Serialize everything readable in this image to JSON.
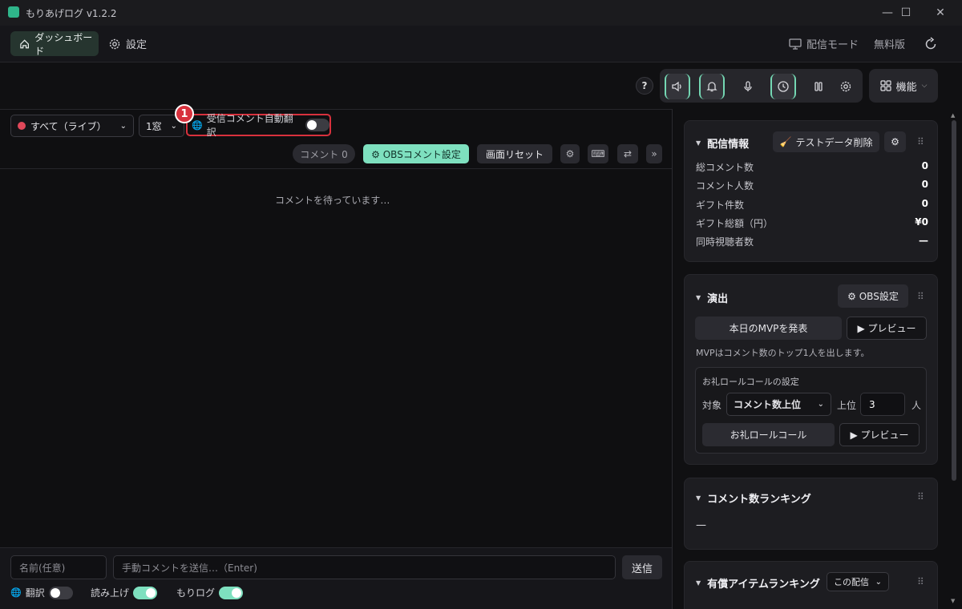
{
  "window": {
    "title": "もりあげログ  v1.2.2",
    "minimize": "—",
    "maximize": "☐",
    "close": "✕"
  },
  "nav": {
    "dashboard": "ダッシュボード",
    "settings": "設定",
    "stream_mode": "配信モード",
    "free_version": "無料版"
  },
  "toolbar": {
    "help": "?",
    "features": "機能"
  },
  "comments": {
    "source_select": "すべて（ライブ）",
    "window_select": "1窓",
    "auto_translate_label": "受信コメント自動翻訳",
    "auto_translate_on": false,
    "annotation_number": "1",
    "comment_count_label": "コメント 0",
    "obs_comment_settings": "⚙ OBSコメント設定",
    "reset_screen": "画面リセット",
    "waiting_text": "コメントを待っています…",
    "icon_gear": "⚙",
    "icon_keyboard": "⌨",
    "icon_swap": "⇄",
    "icon_more": "»"
  },
  "composer": {
    "name_placeholder": "名前(任意)",
    "comment_placeholder": "手動コメントを送信…（Enter)",
    "send": "送信",
    "translate_label": "翻訳",
    "read_aloud_label": "読み上げ",
    "moriloq_label": "もりログ",
    "translate_on": false,
    "read_aloud_on": true,
    "moriloq_on": true
  },
  "stream_info": {
    "title": "配信情報",
    "delete_test_data": "テストデータ削除",
    "rows": [
      {
        "label": "総コメント数",
        "value": "0"
      },
      {
        "label": "コメント人数",
        "value": "0"
      },
      {
        "label": "ギフト件数",
        "value": "0"
      },
      {
        "label": "ギフト総額（円）",
        "value": "¥0"
      },
      {
        "label": "同時視聴者数",
        "value": "—"
      }
    ]
  },
  "effects": {
    "title": "演出",
    "obs_settings": "⚙ OBS設定",
    "announce_mvp": "本日のMVPを発表",
    "preview": "▶ プレビュー",
    "mvp_note": "MVPはコメント数のトップ1人を出します。",
    "rollcall_title": "お礼ロールコールの設定",
    "target_label": "対象",
    "target_value": "コメント数上位",
    "top_label": "上位",
    "top_value": "3",
    "person_unit": "人",
    "rollcall_button": "お礼ロールコール",
    "rollcall_preview": "▶ プレビュー"
  },
  "comment_ranking": {
    "title": "コメント数ランキング",
    "empty": "—"
  },
  "paid_ranking": {
    "title": "有償アイテムランキング",
    "filter": "この配信"
  },
  "colors": {
    "accent": "#7ee0bf",
    "annotation": "#d8313d",
    "background": "#101012",
    "card": "#1d1d21"
  }
}
